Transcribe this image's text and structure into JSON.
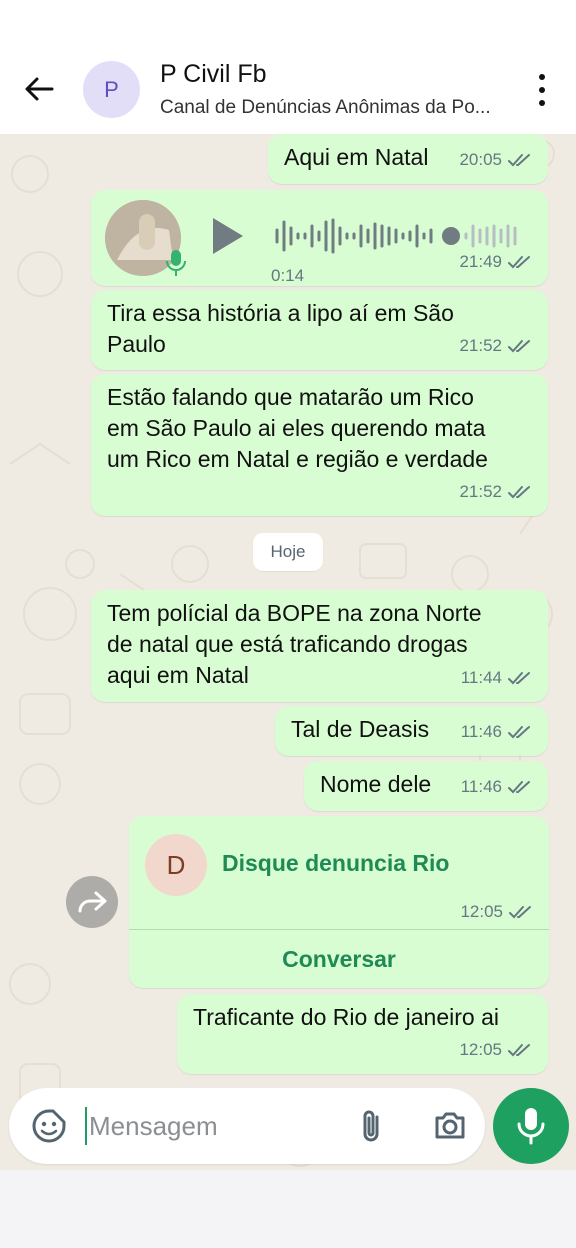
{
  "header": {
    "avatar_letter": "P",
    "title": "P Civil Fb",
    "subtitle": "Canal de Denúncias Anônimas da Po..."
  },
  "messages": [
    {
      "text": "Aqui em Natal",
      "time": "20:05"
    },
    {
      "type": "audio",
      "duration": "0:14",
      "time": "21:49"
    },
    {
      "text": "Tira essa história a lipo aí em São\nPaulo",
      "time": "21:52"
    },
    {
      "text": "Estão falando que matarão um Rico\nem São Paulo ai eles querendo mata\num Rico em Natal e região e verdade",
      "time": "21:52"
    },
    {
      "text": "Tem polícial da BOPE na zona Norte\nde natal que está traficando drogas\naqui em Natal",
      "time": "11:44"
    },
    {
      "text": "Tal de Deasis",
      "time": "11:46"
    },
    {
      "text": "Nome dele",
      "time": "11:46"
    },
    {
      "type": "contact",
      "avatar_letter": "D",
      "name": "Disque denuncia Rio",
      "time": "12:05",
      "action": "Conversar"
    },
    {
      "text": "Traficante do Rio de janeiro ai",
      "time": "12:05"
    }
  ],
  "date_chip": "Hoje",
  "composer": {
    "placeholder": "Mensagem"
  },
  "colors": {
    "outgoing_bubble": "#d9fdd3",
    "accent_green": "#1ea060",
    "contact_green": "#1f8a55",
    "chat_background": "#efeae2"
  },
  "icons": [
    "back-arrow-icon",
    "more-vert-icon",
    "play-icon",
    "mic-icon",
    "read-ticks-icon",
    "forward-icon",
    "sticker-icon",
    "attach-icon",
    "camera-icon"
  ]
}
